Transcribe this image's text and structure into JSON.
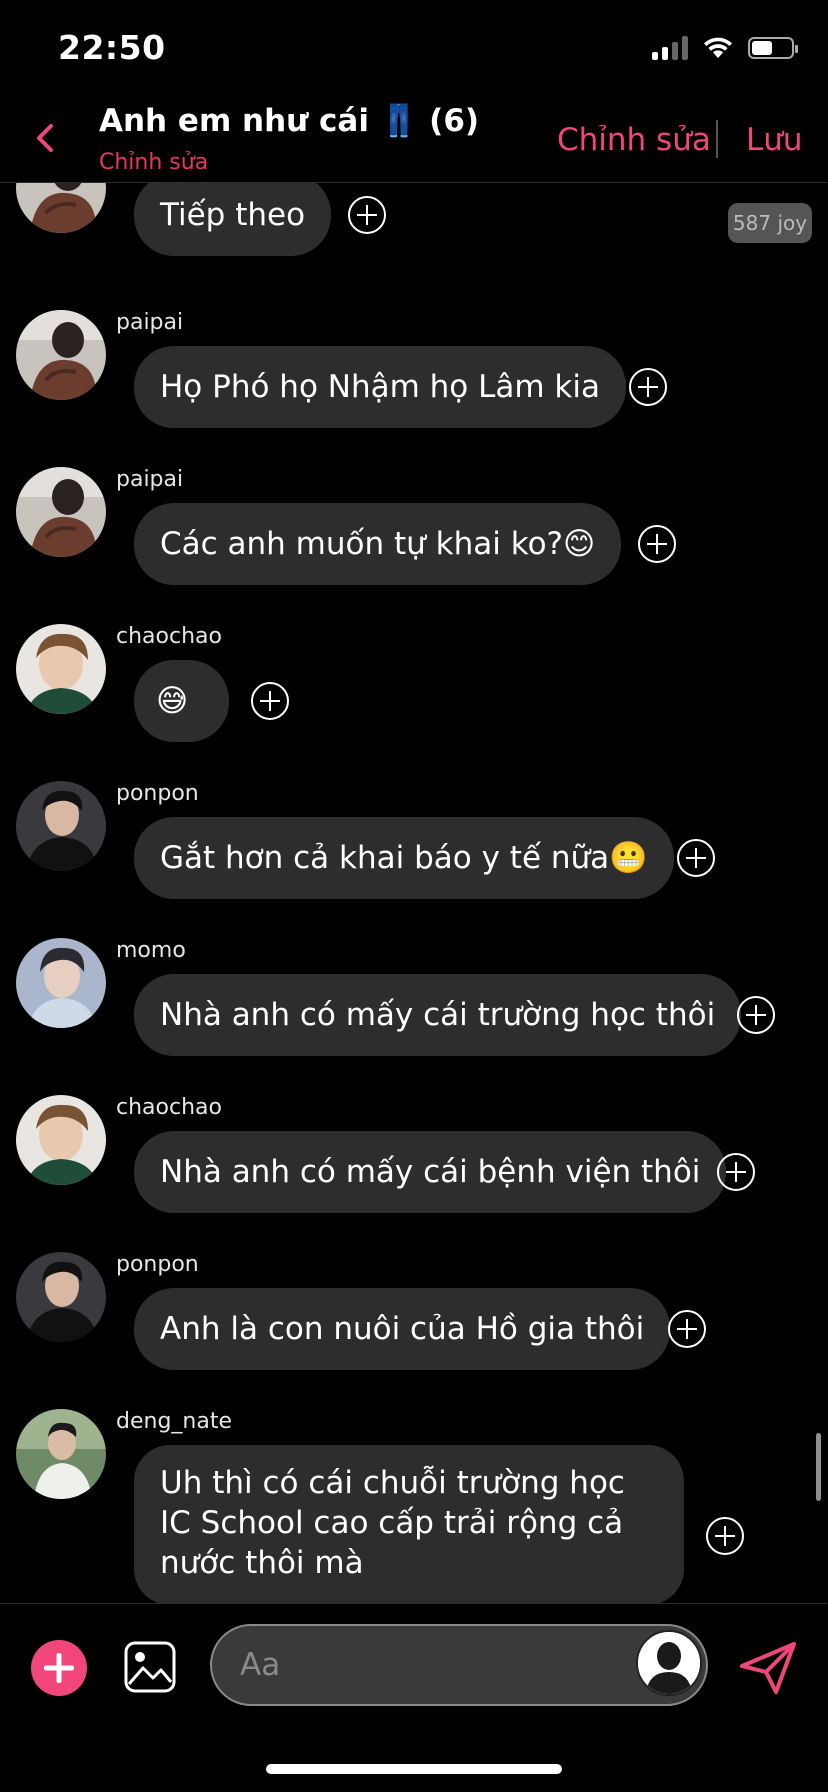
{
  "status_bar": {
    "time": "22:50"
  },
  "header": {
    "title": "Anh em như cái 👖 (6)",
    "subtitle": "Chỉnh sửa",
    "edit_label": "Chỉnh sửa",
    "save_label": "Lưu"
  },
  "messages": [
    {
      "sender": "",
      "text": "Tiếp theo",
      "badge": "587 joy",
      "avatar": "paipai"
    },
    {
      "sender": "paipai",
      "text": "Họ Phó họ Nhậm họ Lâm kia",
      "avatar": "paipai"
    },
    {
      "sender": "paipai",
      "text": "Các anh muốn tự khai ko?😊",
      "avatar": "paipai"
    },
    {
      "sender": "chaochao",
      "text": "😅",
      "avatar": "chaochao"
    },
    {
      "sender": "ponpon",
      "text": "Gắt hơn cả khai báo y tế nữa😬",
      "avatar": "ponpon"
    },
    {
      "sender": "momo",
      "text": "Nhà anh có mấy cái trường học thôi",
      "avatar": "momo"
    },
    {
      "sender": "chaochao",
      "text": "Nhà anh có mấy cái bệnh viện thôi",
      "avatar": "chaochao"
    },
    {
      "sender": "ponpon",
      "text": "Anh là con nuôi của Hồ gia thôi",
      "avatar": "ponpon"
    },
    {
      "sender": "deng_nate",
      "text": "Uh thì có cái chuỗi trường học IC School cao cấp trải rộng cả nước thôi mà",
      "avatar": "deng_nate"
    }
  ],
  "composer": {
    "placeholder": "Aa"
  },
  "icons": {
    "back": "chevron-left-icon",
    "add": "plus-icon",
    "image": "image-icon",
    "send": "send-icon",
    "reaction": "plus-circle-icon"
  },
  "colors": {
    "accent": "#f0467a",
    "bubble": "#2d2d2d",
    "background": "#000000"
  }
}
